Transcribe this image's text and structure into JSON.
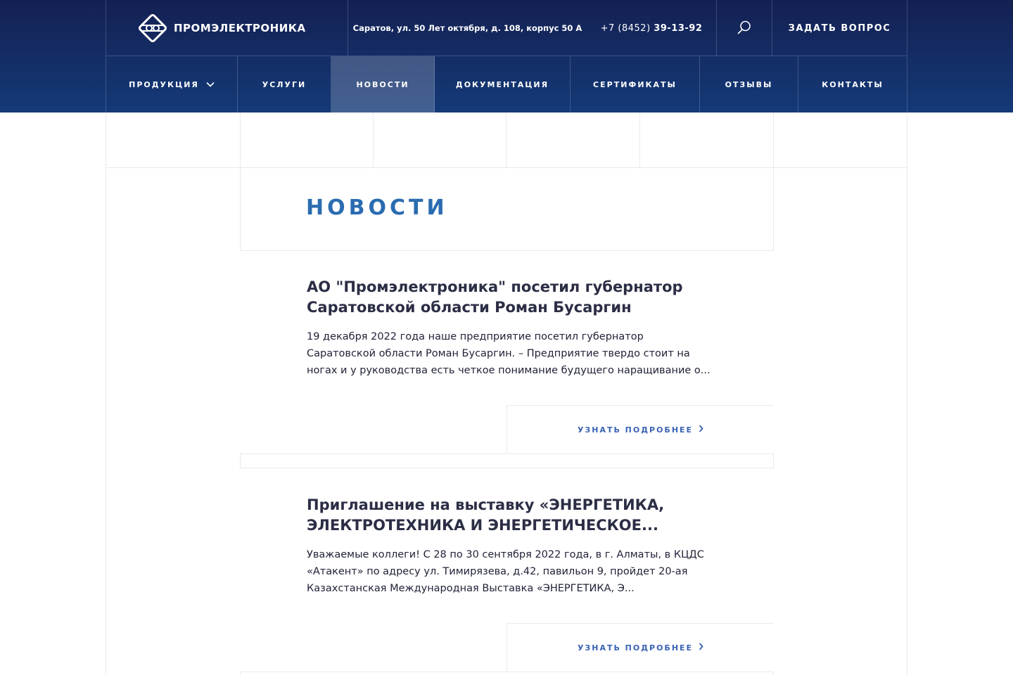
{
  "header": {
    "logo_text": "ПРОМЭЛЕКТРОНИКА",
    "address": "Саратов, ул. 50 Лет октября, д. 108, корпус 50 А",
    "phone_prefix": "+7 (8452) ",
    "phone_number": "39-13-92",
    "ask_button": "ЗАДАТЬ ВОПРОС"
  },
  "nav": {
    "items": [
      {
        "label": "ПРОДУКЦИЯ"
      },
      {
        "label": "УСЛУГИ"
      },
      {
        "label": "НОВОСТИ"
      },
      {
        "label": "ДОКУМЕНТАЦИЯ"
      },
      {
        "label": "СЕРТИФИКАТЫ"
      },
      {
        "label": "ОТЗЫВЫ"
      },
      {
        "label": "КОНТАКТЫ"
      }
    ],
    "active": "НОВОСТИ"
  },
  "main": {
    "title": "НОВОСТИ",
    "news": [
      {
        "title": "АО \"Промэлектроника\" посетил губернатор Саратовской области Роман Бусаргин",
        "text": "19 декабря 2022 года наше предприятие посетил губернатор Саратовской области Роман Бусаргин. – Предприятие твердо стоит на ногах и у руководства есть четкое понимание будущего наращивание о...",
        "more": "УЗНАТЬ ПОДРОБНЕЕ"
      },
      {
        "title": "Приглашение на выставку «ЭНЕРГЕТИКА, ЭЛЕКТРОТЕХНИКА И ЭНЕРГЕТИЧЕСКОЕ...",
        "text": "Уважаемые коллеги! С 28 по 30 сентября 2022 года, в г. Алматы, в КЦДС «Атакент» по адресу ул. Тимирязева, д.42, павильон 9, пройдет 20-ая Казахстанская Международная Выставка «ЭНЕРГЕТИКА, Э...",
        "more": "УЗНАТЬ ПОДРОБНЕЕ"
      }
    ]
  },
  "colors": {
    "header_top": "#142052",
    "header_bottom": "#143a78",
    "accent_title": "#2a6cb0",
    "link": "#3a63b3"
  },
  "icons": {
    "logo": "promelectronica-logo-icon",
    "search": "search-icon",
    "nav_dropdown": "chevron-down-icon",
    "more": "chevron-right-icon"
  }
}
